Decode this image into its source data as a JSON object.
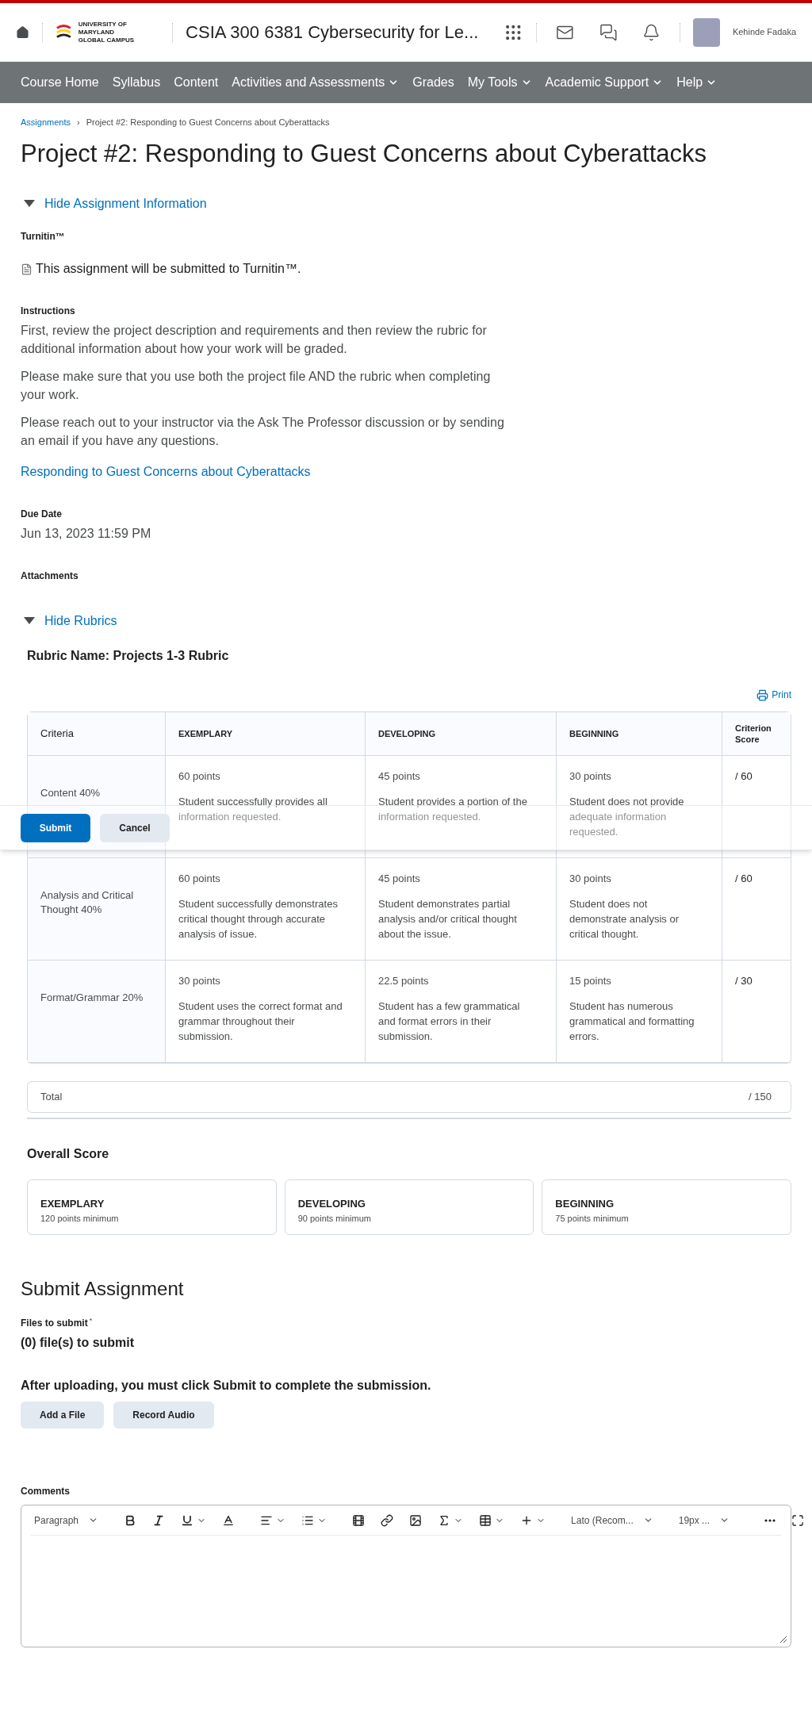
{
  "header": {
    "logo_lines": [
      "UNIVERSITY OF MARYLAND",
      "GLOBAL CAMPUS"
    ],
    "course_title": "CSIA 300 6381 Cybersecurity for Le...",
    "user_name": "Kehinde Fadaka"
  },
  "nav": [
    {
      "label": "Course Home",
      "dropdown": false
    },
    {
      "label": "Syllabus",
      "dropdown": false
    },
    {
      "label": "Content",
      "dropdown": false
    },
    {
      "label": "Activities and Assessments",
      "dropdown": true
    },
    {
      "label": "Grades",
      "dropdown": false
    },
    {
      "label": "My Tools",
      "dropdown": true
    },
    {
      "label": "Academic Support",
      "dropdown": true
    },
    {
      "label": "Help",
      "dropdown": true
    }
  ],
  "breadcrumb": {
    "parent": "Assignments",
    "separator": "›",
    "current": "Project #2: Responding to Guest Concerns about Cyberattacks"
  },
  "title": "Project #2: Responding to Guest Concerns about Cyberattacks",
  "assignment_info": {
    "toggle_label": "Hide Assignment Information",
    "expanded": true,
    "turnitin": {
      "label": "Turnitin™",
      "text": "This assignment will be submitted to Turnitin™."
    },
    "instructions": {
      "label": "Instructions",
      "paragraphs": [
        "First, review the project description and requirements and then review the rubric for additional information about how your work will be graded.",
        "Please make sure that you use both the project file AND the rubric when completing your work.",
        "Please reach out to your instructor via the Ask The Professor discussion or by sending an email if you have any questions."
      ],
      "link": "Responding to Guest Concerns about Cyberattacks"
    },
    "due": {
      "label": "Due Date",
      "value": "Jun 13, 2023 11:59 PM"
    },
    "attachments_label": "Attachments"
  },
  "rubric": {
    "toggle_label": "Hide Rubrics",
    "expanded": true,
    "name": "Rubric Name: Projects 1-3 Rubric",
    "print_label": "Print",
    "columns": [
      "Criteria",
      "EXEMPLARY",
      "DEVELOPING",
      "BEGINNING",
      "Criterion Score"
    ],
    "rows": [
      {
        "cells": [
          {
            "text": "Content 40%"
          },
          {
            "points": "60 points",
            "description": "Student successfully provides all information requested."
          },
          {
            "points": "45 points",
            "description": "Student provides a portion of the information requested."
          },
          {
            "points": "30 points",
            "description": "Student does not provide adequate information requested."
          },
          {
            "text": "/ 60"
          }
        ]
      },
      {
        "cells": [
          {
            "text": "Analysis and Critical Thought 40%"
          },
          {
            "points": "60 points",
            "description": "Student successfully demonstrates critical thought through accurate analysis of issue."
          },
          {
            "points": "45 points",
            "description": "Student demonstrates partial analysis and/or critical thought about the issue."
          },
          {
            "points": "30 points",
            "description": "Student does not demonstrate analysis or critical thought."
          },
          {
            "text": "/ 60"
          }
        ]
      },
      {
        "cells": [
          {
            "text": "Format/Grammar 20%"
          },
          {
            "points": "30 points",
            "description": "Student uses the correct format and grammar throughout their submission."
          },
          {
            "points": "22.5 points",
            "description": "Student has a few grammatical and format errors in their submission."
          },
          {
            "points": "15 points",
            "description": "Student has numerous grammatical and formatting errors."
          },
          {
            "text": "/ 30"
          }
        ]
      }
    ],
    "total": {
      "label": "Total",
      "score": "/ 150"
    }
  },
  "overall": {
    "title": "Overall Score",
    "levels": [
      {
        "name": "EXEMPLARY",
        "minimum": "120 points minimum"
      },
      {
        "name": "DEVELOPING",
        "minimum": "90 points minimum"
      },
      {
        "name": "BEGINNING",
        "minimum": "75 points minimum"
      }
    ]
  },
  "submit": {
    "title": "Submit Assignment",
    "files_label": "Files to submit",
    "required_mark": "*",
    "files_count": "(0) file(s) to submit",
    "notice": "After uploading, you must click Submit to complete the submission.",
    "buttons": [
      "Add a File",
      "Record Audio"
    ]
  },
  "comments": {
    "label": "Comments",
    "toolbar": [
      {
        "kind": "select",
        "label": "Paragraph"
      },
      {
        "kind": "divider"
      },
      {
        "kind": "button",
        "dropdown": false
      },
      {
        "kind": "button",
        "dropdown": false
      },
      {
        "kind": "button",
        "dropdown": true
      },
      {
        "kind": "button",
        "dropdown": false
      },
      {
        "kind": "divider"
      },
      {
        "kind": "button",
        "dropdown": true
      },
      {
        "kind": "button",
        "dropdown": true
      },
      {
        "kind": "divider"
      },
      {
        "kind": "button",
        "dropdown": false
      },
      {
        "kind": "button",
        "dropdown": false
      },
      {
        "kind": "button",
        "dropdown": false
      },
      {
        "kind": "button",
        "dropdown": true
      },
      {
        "kind": "button",
        "dropdown": true
      },
      {
        "kind": "button",
        "dropdown": true
      },
      {
        "kind": "divider"
      },
      {
        "kind": "select",
        "label": "Lato (Recom..."
      },
      {
        "kind": "divider"
      },
      {
        "kind": "select",
        "label": "19px ..."
      },
      {
        "kind": "divider"
      },
      {
        "kind": "spacer"
      },
      {
        "kind": "button",
        "dropdown": false
      },
      {
        "kind": "button",
        "dropdown": false
      }
    ]
  },
  "floating_bar": {
    "buttons": [
      {
        "label": "Submit",
        "kind": "primary"
      },
      {
        "label": "Cancel",
        "kind": "secondary"
      }
    ]
  }
}
